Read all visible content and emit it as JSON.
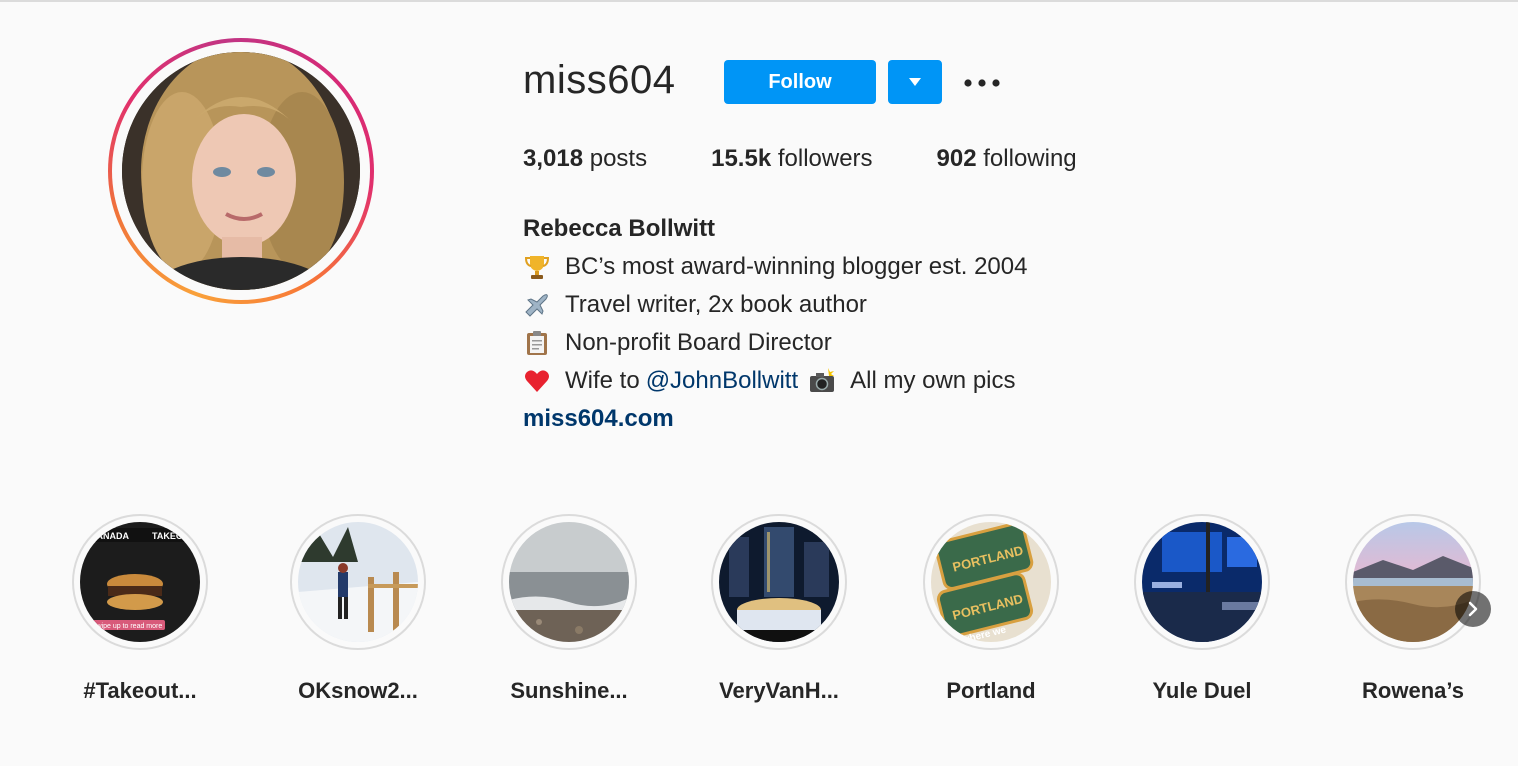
{
  "profile": {
    "username": "miss604",
    "follow_label": "Follow",
    "more_icon": "more-dots-icon",
    "dropdown_icon": "caret-down-icon"
  },
  "stats": [
    {
      "count": "3,018",
      "label": "posts"
    },
    {
      "count": "15.5k",
      "label": "followers"
    },
    {
      "count": "902",
      "label": "following"
    }
  ],
  "bio": {
    "name": "Rebecca Bollwitt",
    "lines": [
      {
        "icon": "trophy-icon",
        "text": "BC’s most award-winning blogger est. 2004"
      },
      {
        "icon": "airplane-icon",
        "text": "Travel writer, 2x book author"
      },
      {
        "icon": "clipboard-icon",
        "text": "Non-profit Board Director"
      }
    ],
    "last_line": {
      "icon": "heart-icon",
      "prefix": "Wife to",
      "mention": "@JohnBollwitt",
      "camera_icon": "camera-flash-icon",
      "suffix": "All my own pics"
    },
    "website": "miss604.com"
  },
  "highlights": [
    {
      "label": "#Takeout..."
    },
    {
      "label": "OKsnow2..."
    },
    {
      "label": "Sunshine..."
    },
    {
      "label": "VeryVanH..."
    },
    {
      "label": "Portland"
    },
    {
      "label": "Yule Duel"
    },
    {
      "label": "Rowena’s"
    }
  ],
  "highlight_thumb_text": {
    "takeout": [
      "CANADA",
      "TAKEO",
      "swipe up to read more"
    ],
    "portland": [
      "PORTLAND",
      "PORTLAND",
      "where we"
    ]
  },
  "colors": {
    "accent": "#0095f6",
    "link": "#00376b",
    "text": "#262626",
    "background": "#fafafa"
  }
}
